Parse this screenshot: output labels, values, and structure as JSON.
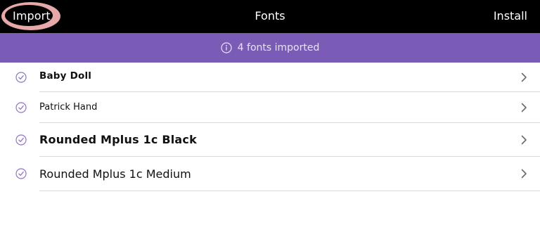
{
  "topbar": {
    "import_label": "Import",
    "title": "Fonts",
    "install_label": "Install"
  },
  "banner": {
    "text": "4 fonts imported",
    "icon": "info-circle-icon"
  },
  "fonts": [
    {
      "name": "Baby Doll",
      "status_icon": "check-circle-icon"
    },
    {
      "name": "Patrick Hand",
      "status_icon": "check-circle-icon"
    },
    {
      "name": "Rounded Mplus 1c Black",
      "status_icon": "check-circle-icon"
    },
    {
      "name": "Rounded Mplus 1c Medium",
      "status_icon": "check-circle-icon"
    }
  ],
  "colors": {
    "topbar_bg": "#000000",
    "banner_bg": "#7a5cb6",
    "accent": "#7a5cb6",
    "import_highlight": "#e6a8a8"
  }
}
